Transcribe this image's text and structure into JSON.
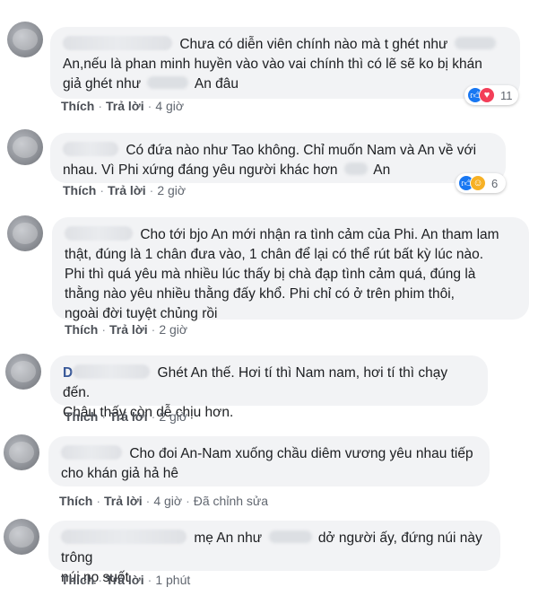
{
  "actions": {
    "like": "Thích",
    "reply": "Trả lời",
    "edited": "Đã chỉnh sửa"
  },
  "icons": {
    "like": "thumbs-up-icon",
    "love": "heart-icon",
    "haha": "laughing-face-icon"
  },
  "colors": {
    "bubble": "#f2f3f5",
    "like_blue": "#1877f2",
    "love_red": "#f33e58",
    "haha_yellow": "#f7b125"
  },
  "comments": [
    {
      "lines": [
        "Chưa có diễn viên chính nào mà t ghét như",
        "An,nếu là phan minh huyền vào vào vai chính thì có lẽ sẽ ko bị khán",
        "giả ghét như",
        "An đâu"
      ],
      "time": "4 giờ",
      "reaction_count": "11"
    },
    {
      "lines": [
        "Có đứa nào như Tao không. Chỉ muốn Nam và An về với",
        "nhau. Vì Phi xứng đáng yêu người khác hơn",
        "An"
      ],
      "time": "2 giờ",
      "reaction_count": "6"
    },
    {
      "lines": [
        "Cho tới bjo An mới nhận ra tình cảm của Phi. An tham lam",
        "thật, đúng là 1 chân đưa vào, 1 chân để lại có thể rút bất kỳ lúc nào.",
        "Phi thì quá yêu mà nhiều lúc thấy bị chà đạp tình cảm quá, đúng là",
        "thằng nào yêu nhiều thằng đấy khổ. Phi chỉ có ở trên phim thôi,",
        "ngoài đời tuyệt chủng rồi"
      ],
      "time": "2 giờ"
    },
    {
      "lines": [
        "Ghét An thế. Hơi tí thì Nam nam, hơi tí thì chạy đến.",
        "Châu thấy còn dễ chịu hơn."
      ],
      "name_initial": "D",
      "time": "2 giờ"
    },
    {
      "lines": [
        "Cho đoi An-Nam xuống chầu diêm vương yêu nhau tiếp",
        "cho khán giả hả hê"
      ],
      "time": "4 giờ"
    },
    {
      "lines": [
        "mẹ An như",
        "dở người ấy, đứng núi này trông",
        "núi nọ suốt"
      ],
      "time": "1 phút"
    }
  ]
}
